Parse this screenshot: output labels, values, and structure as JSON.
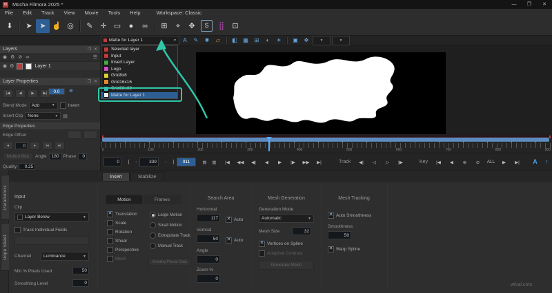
{
  "window": {
    "title": "Mocha Filmora 2025 *",
    "icon_letter": "m",
    "minimize": "—",
    "maximize": "❐",
    "close": "✕"
  },
  "menubar": {
    "items": [
      "File",
      "Edit",
      "Track",
      "View",
      "Movie",
      "Tools",
      "Help"
    ],
    "workspace": "Workspace: Classic"
  },
  "toolbar": {
    "icons": [
      {
        "name": "save-icon",
        "glyph": "⬇"
      },
      {
        "name": "toolbar-divider",
        "divider": true
      },
      {
        "name": "select-tool-icon",
        "glyph": "➤"
      },
      {
        "name": "select-alt-tool-icon",
        "glyph": "➤",
        "active": true
      },
      {
        "name": "pan-tool-icon",
        "glyph": "☝"
      },
      {
        "name": "zoom-tool-icon",
        "glyph": "◎"
      },
      {
        "name": "toolbar-divider",
        "divider": true
      },
      {
        "name": "spline-pen-icon",
        "glyph": "✎"
      },
      {
        "name": "add-point-icon",
        "glyph": "✛"
      },
      {
        "name": "rect-tool-icon",
        "glyph": "▭"
      },
      {
        "name": "ellipse-tool-icon",
        "glyph": "●"
      },
      {
        "name": "link-tool-icon",
        "glyph": "∞"
      },
      {
        "name": "toolbar-divider",
        "divider": true
      },
      {
        "name": "transform-grid-icon",
        "glyph": "⊞"
      },
      {
        "name": "crosshair-icon",
        "glyph": "⌖"
      },
      {
        "name": "expand-tool-icon",
        "glyph": "✥"
      },
      {
        "name": "stabilize-module-icon",
        "glyph": "S",
        "boxed": true
      },
      {
        "name": "mesh-grid-icon",
        "glyph": "⣿",
        "color": "#cf4fd0"
      },
      {
        "name": "module-icon",
        "glyph": "⊡"
      }
    ]
  },
  "viewbar": {
    "selected_matte": "Matte for Layer 1",
    "icons": [
      {
        "name": "text-overlay-icon",
        "glyph": "A"
      },
      {
        "name": "spline-overlay-icon",
        "glyph": "✎"
      },
      {
        "name": "point-overlay-icon",
        "glyph": "✱"
      },
      {
        "name": "surface-overlay-icon",
        "glyph": "▱",
        "color": "#e0a040"
      },
      {
        "name": "viewbar-divider",
        "divider": true
      },
      {
        "name": "matte-view-icon",
        "glyph": "◧"
      },
      {
        "name": "overlay-view-icon",
        "glyph": "▦"
      },
      {
        "name": "grid-view-icon",
        "glyph": "⊞"
      },
      {
        "name": "contrast-view-icon",
        "glyph": "◐"
      },
      {
        "name": "brightness-view-icon",
        "glyph": "☀"
      },
      {
        "name": "viewbar-divider",
        "divider": true
      },
      {
        "name": "color-sample-icon",
        "glyph": "▣"
      },
      {
        "name": "stabilize-view-icon",
        "glyph": "✥"
      },
      {
        "name": "zoom-level-select",
        "glyph": "▼",
        "wide": true
      },
      {
        "name": "view-scale-select",
        "glyph": "▼",
        "wide": true
      }
    ]
  },
  "layers": {
    "title": "Layers",
    "layer_name": "Layer 1",
    "dock_icon": "❐",
    "close_icon": "✕",
    "eye_icon": "◉",
    "gear_icon": "⚙",
    "lock_icon": "⊘",
    "link_icon": "∞",
    "menu_icon": "☰"
  },
  "dropdown": {
    "items": [
      {
        "label": "Selected layer",
        "color": "#c23b3b"
      },
      {
        "label": "Input",
        "color": "#c23b3b"
      },
      {
        "label": "Insert Layer",
        "color": "#44aa44"
      },
      {
        "label": "Logo",
        "color": "#cf4fc9"
      },
      {
        "label": "Grid8x8",
        "color": "#ddd23a"
      },
      {
        "label": "Grid16x16",
        "color": "#dd8c2e"
      },
      {
        "label": "Grid32x32",
        "color": "#3fb9b9"
      },
      {
        "label": "Matte for Layer 1",
        "color": "#f2f2f2",
        "highlight": true
      }
    ]
  },
  "props": {
    "title": "Layer Properties",
    "dock_icon": "❐",
    "close_icon": "✕",
    "nav_buttons": [
      "|◀",
      "◀",
      "▶",
      "▶|"
    ],
    "out_value": "0.0",
    "link_icon": "⊕",
    "blend_label": "Blend Mode",
    "blend_value": "Add",
    "invert_label": "Invert",
    "insert_clip_label": "Insert Clip",
    "insert_clip_value": "None",
    "menu_icon": "▤",
    "edge_header": "Edge Properties",
    "edge_offset_label": "Edge Offset",
    "offset_spin": [
      "◂",
      "▸"
    ],
    "offset_value": "0",
    "offset_extra": [
      "|◂",
      "▸|"
    ],
    "motion_blur": "Motion Blur",
    "angle_label": "Angle",
    "angle_value": "180",
    "phase_label": "Phase",
    "phase_value": "0",
    "quality_label": "Quality",
    "quality_value": "0.25"
  },
  "timeline": {
    "ruler_labels": [
      "0",
      "100",
      "200",
      "300",
      "400",
      "500",
      "600",
      "700",
      "800",
      "900"
    ]
  },
  "transport": {
    "in_value": "0",
    "bracket_open": "[",
    "dash_a": "-",
    "current": "339",
    "dash_b": "-",
    "bracket_close": "]",
    "out_value": "911",
    "view_a": "▤",
    "view_b": "▥",
    "buttons": [
      "|◀",
      "◀◀",
      "◀|",
      "◀",
      "▶",
      "|▶",
      "▶▶",
      "▶|"
    ],
    "track_label": "Track",
    "track_buttons": [
      "◀|",
      "◁",
      "▷",
      "|▶"
    ],
    "key_label": "Key",
    "key_buttons": [
      "|◀",
      "◀",
      "⊗",
      "⊘",
      "ALL",
      "▶",
      "▶|"
    ],
    "autokey_label": "A",
    "up_icon": "↑"
  },
  "panel": {
    "tabs": [
      {
        "label": "Insert",
        "active": true
      },
      {
        "label": "Stabilize"
      }
    ],
    "side_tabs": [
      "Parameters",
      "Dope Sheet"
    ],
    "input": {
      "header": "Input",
      "clip_label": "Clip",
      "clip_value": "Layer Below",
      "fields_label": "Track Individual Fields",
      "channel_label": "Channel",
      "channel_value": "Luminance",
      "min_label": "Min % Pixels Used",
      "min_value": "50",
      "smooth_label": "Smoothing Level",
      "smooth_value": "0"
    },
    "motion": {
      "btn_motion": "Motion",
      "btn_frames": "Frames",
      "checks": [
        {
          "label": "Translation",
          "checked": true
        },
        {
          "label": "Scale"
        },
        {
          "label": "Rotation"
        },
        {
          "label": "Shear"
        },
        {
          "label": "Perspective"
        },
        {
          "label": "Mesh",
          "disabled": true
        }
      ],
      "radios": [
        {
          "label": "Large Motion",
          "checked": true
        },
        {
          "label": "Small Motion"
        },
        {
          "label": "Extrapolate Track"
        },
        {
          "label": "Manual Track"
        }
      ],
      "planar_btn": "Existing Planar Data"
    },
    "search": {
      "header": "Search Area",
      "h_label": "Horizontal",
      "h_value": "117",
      "auto_label": "Auto",
      "v_label": "Vertical",
      "v_value": "50",
      "angle_label": "Angle",
      "angle_value": "0",
      "zoom_label": "Zoom %",
      "zoom_value": "0"
    },
    "meshgen": {
      "header": "Mesh Generation",
      "mode_label": "Generation Mode",
      "mode_value": "Automatic",
      "size_label": "Mesh Size",
      "size_value": "32",
      "vertices_label": "Vertices on Spline",
      "adaptive_label": "Adaptive Contrast",
      "generate_btn": "Generate Mesh"
    },
    "meshtrack": {
      "header": "Mesh Tracking",
      "auto_label": "Auto Smoothness",
      "smooth_label": "Smoothness",
      "smooth_value": "50",
      "warp_label": "Warp Spline"
    }
  },
  "annotation_color": "#2fc7a8",
  "watermark": "wfval.com"
}
